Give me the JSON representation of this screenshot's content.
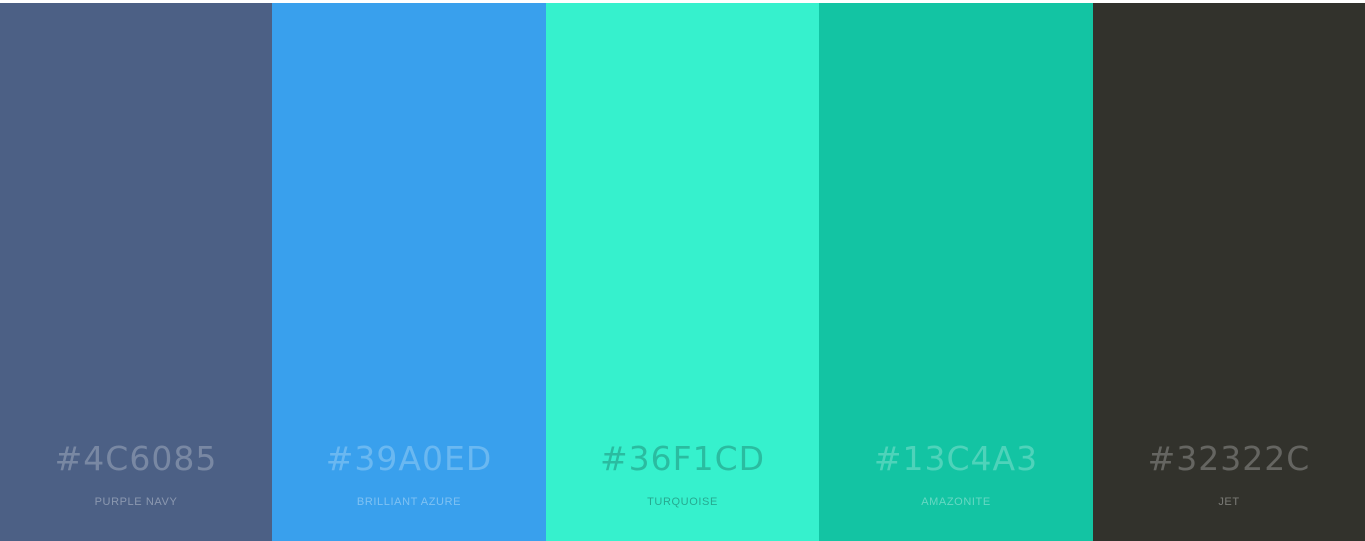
{
  "palette": {
    "swatches": [
      {
        "hex": "#4C6085",
        "name": "PURPLE NAVY",
        "color": "#4C6085"
      },
      {
        "hex": "#39A0ED",
        "name": "BRILLIANT AZURE",
        "color": "#39A0ED"
      },
      {
        "hex": "#36F1CD",
        "name": "TURQUOISE",
        "color": "#36F1CD"
      },
      {
        "hex": "#13C4A3",
        "name": "AMAZONITE",
        "color": "#13C4A3"
      },
      {
        "hex": "#32322C",
        "name": "JET",
        "color": "#32322C"
      }
    ]
  }
}
